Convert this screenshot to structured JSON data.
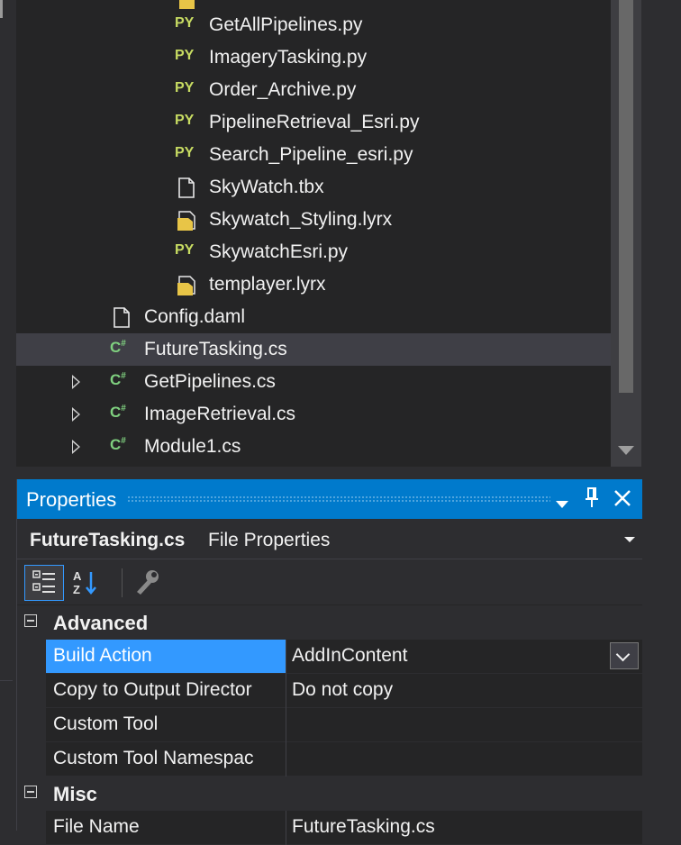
{
  "tree": {
    "items": [
      {
        "label": "GetAllPipelines.py",
        "icon": "py",
        "indent": 2
      },
      {
        "label": "ImageryTasking.py",
        "icon": "py",
        "indent": 2
      },
      {
        "label": "Order_Archive.py",
        "icon": "py",
        "indent": 2
      },
      {
        "label": "PipelineRetrieval_Esri.py",
        "icon": "py",
        "indent": 2
      },
      {
        "label": "Search_Pipeline_esri.py",
        "icon": "py",
        "indent": 2
      },
      {
        "label": "SkyWatch.tbx",
        "icon": "doc",
        "indent": 2
      },
      {
        "label": "Skywatch_Styling.lyrx",
        "icon": "lyrx",
        "indent": 2
      },
      {
        "label": "SkywatchEsri.py",
        "icon": "py",
        "indent": 2
      },
      {
        "label": "templayer.lyrx",
        "icon": "lyrx",
        "indent": 2
      },
      {
        "label": "Config.daml",
        "icon": "doc",
        "indent": 1
      },
      {
        "label": "FutureTasking.cs",
        "icon": "cs",
        "indent": 1,
        "selected": true
      },
      {
        "label": "GetPipelines.cs",
        "icon": "cs",
        "indent": 1,
        "expandable": true
      },
      {
        "label": "ImageRetrieval.cs",
        "icon": "cs",
        "indent": 1,
        "expandable": true
      },
      {
        "label": "Module1.cs",
        "icon": "cs",
        "indent": 1,
        "expandable": true
      }
    ],
    "py_badge": "PY",
    "cs_badge": "C",
    "cs_badge_sup": "#"
  },
  "properties": {
    "title": "Properties",
    "subject_name": "FutureTasking.cs",
    "subject_type": "File Properties",
    "categories": [
      {
        "label": "Advanced",
        "rows": [
          {
            "name": "Build Action",
            "value": "AddInContent",
            "selected": true,
            "dropdown": true
          },
          {
            "name": "Copy to Output Director",
            "value": "Do not copy"
          },
          {
            "name": "Custom Tool",
            "value": ""
          },
          {
            "name": "Custom Tool Namespac",
            "value": ""
          }
        ]
      },
      {
        "label": "Misc",
        "rows": [
          {
            "name": "File Name",
            "value": "FutureTasking.cs"
          }
        ]
      }
    ]
  },
  "colors": {
    "accent": "#007acc",
    "selection": "#3399ff",
    "py_icon": "#c7db62",
    "cs_icon": "#7fd07f",
    "lyrx_icon": "#e8c547"
  }
}
